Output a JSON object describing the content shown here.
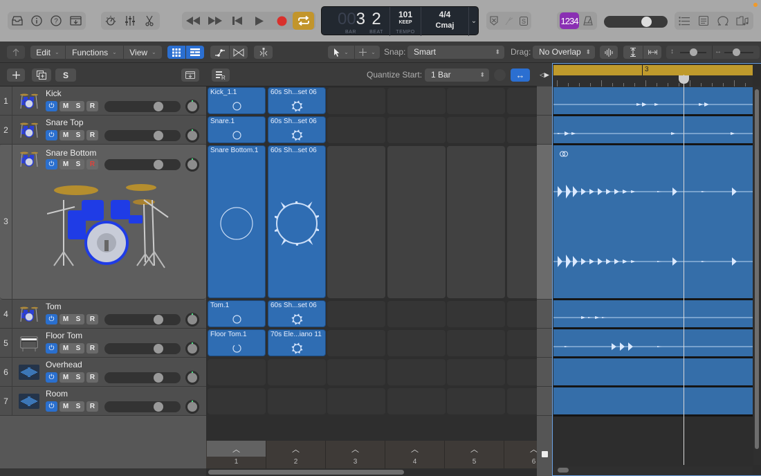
{
  "control_bar": {
    "left_icons": [
      "library-icon",
      "inspector-icon",
      "quick-help-icon",
      "download-icon"
    ],
    "edit_icons": [
      "smart-controls-icon",
      "mixer-icon",
      "editors-icon"
    ],
    "transport": [
      "rewind-icon",
      "fast-forward-icon",
      "go-to-beginning-icon",
      "play-icon",
      "record-icon",
      "cycle-icon"
    ],
    "lcd": {
      "bar_dim": "00",
      "bar": "3",
      "beat": "2",
      "bar_label": "BAR",
      "beat_label": "BEAT",
      "tempo": "101",
      "tempo_mode": "KEEP",
      "tempo_label": "TEMPO",
      "signature": "4/4",
      "key": "Cmaj"
    },
    "mode_icons": [
      "replace-icon",
      "tuner-icon",
      "solo-icon"
    ],
    "count_in": "1234",
    "master_volume": 0.7,
    "right_icons": [
      "list-editors-icon",
      "notepad-icon",
      "loop-browser-icon",
      "browser-icon"
    ]
  },
  "toolbar": {
    "menus": [
      "Edit",
      "Functions",
      "View"
    ],
    "snap_label": "Snap:",
    "snap_value": "Smart",
    "drag_label": "Drag:",
    "drag_value": "No Overlap"
  },
  "track_header": {
    "quantize_label": "Quantize Start:",
    "quantize_value": "1 Bar",
    "solo_label": "S"
  },
  "tracks": [
    {
      "num": "1",
      "name": "Kick",
      "icon": "drum-kit-icon",
      "power": "⏻",
      "mute": "M",
      "solo": "S",
      "rec": "R",
      "armed": false
    },
    {
      "num": "2",
      "name": "Snare Top",
      "icon": "drum-kit-icon",
      "power": "⏻",
      "mute": "M",
      "solo": "S",
      "rec": "R",
      "armed": false
    },
    {
      "num": "3",
      "name": "Snare Bottom",
      "icon": "drum-kit-icon",
      "power": "⏻",
      "mute": "M",
      "solo": "S",
      "rec": "R",
      "armed": true
    },
    {
      "num": "4",
      "name": "Tom",
      "icon": "drum-kit-icon",
      "power": "⏻",
      "mute": "M",
      "solo": "S",
      "rec": "R",
      "armed": false
    },
    {
      "num": "5",
      "name": "Floor Tom",
      "icon": "electric-piano-icon",
      "power": "⏻",
      "mute": "M",
      "solo": "S",
      "rec": "R",
      "armed": false
    },
    {
      "num": "6",
      "name": "Overhead",
      "icon": "audio-waveform-icon",
      "power": "⏻",
      "mute": "M",
      "solo": "S",
      "rec": "R",
      "armed": false
    },
    {
      "num": "7",
      "name": "Room",
      "icon": "audio-waveform-icon",
      "power": "⏻",
      "mute": "M",
      "solo": "S",
      "rec": "R",
      "armed": false
    }
  ],
  "live_loops": {
    "cells": [
      {
        "row": 0,
        "col": 0,
        "name": "Kick_1.1"
      },
      {
        "row": 0,
        "col": 1,
        "name": "60s Sh...set 06"
      },
      {
        "row": 1,
        "col": 0,
        "name": "Snare.1"
      },
      {
        "row": 1,
        "col": 1,
        "name": "60s Sh...set 06"
      },
      {
        "row": 2,
        "col": 0,
        "name": "Snare Bottom.1"
      },
      {
        "row": 2,
        "col": 1,
        "name": "60s Sh...set 06"
      },
      {
        "row": 3,
        "col": 0,
        "name": "Tom.1"
      },
      {
        "row": 3,
        "col": 1,
        "name": "60s Sh...set 06"
      },
      {
        "row": 4,
        "col": 0,
        "name": "Floor Tom.1"
      },
      {
        "row": 4,
        "col": 1,
        "name": "70s Ele...iano 11"
      }
    ],
    "scenes": [
      "1",
      "2",
      "3",
      "4",
      "5",
      "6"
    ],
    "scene_trigger": "︿"
  },
  "timeline": {
    "cycle_marker": "3"
  }
}
